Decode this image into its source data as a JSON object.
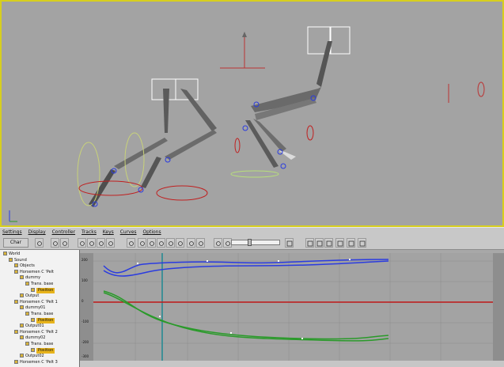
{
  "menubar": {
    "items": [
      "Settings",
      "Display",
      "Controller",
      "Tracks",
      "Keys",
      "Curves",
      "Options"
    ]
  },
  "toolbar": {
    "left_button_label": "Char",
    "icons": [
      "filter-icon",
      "move-keys-icon",
      "slide-keys-icon",
      "scale-keys-icon",
      "scale-values-icon",
      "add-keys-icon",
      "set-tangents-spline-icon",
      "set-tangents-fast-icon",
      "set-tangents-slow-icon",
      "set-tangents-step-icon",
      "set-tangents-linear-icon",
      "set-tangents-smooth-icon",
      "pan-icon",
      "zoom-horizontal-icon",
      "zoom-icon",
      "zoom-region-icon",
      "frame-icon"
    ]
  },
  "outliner": {
    "rows": [
      {
        "label": "World",
        "indent": 0,
        "highlight": false
      },
      {
        "label": "Sound",
        "indent": 1,
        "highlight": false
      },
      {
        "label": "Objects",
        "indent": 2,
        "highlight": false
      },
      {
        "label": "Horsemen C 'Pelt",
        "indent": 2,
        "highlight": false
      },
      {
        "label": "dummy",
        "indent": 3,
        "highlight": false
      },
      {
        "label": "Trans. base",
        "indent": 4,
        "highlight": false
      },
      {
        "label": "Position",
        "indent": 5,
        "highlight": true
      },
      {
        "label": "Output",
        "indent": 3,
        "highlight": false
      },
      {
        "label": "Horsemen C 'Pelt 1",
        "indent": 2,
        "highlight": false
      },
      {
        "label": "dummy01",
        "indent": 3,
        "highlight": false
      },
      {
        "label": "Trans. base",
        "indent": 4,
        "highlight": false
      },
      {
        "label": "Position",
        "indent": 5,
        "highlight": true
      },
      {
        "label": "Output01",
        "indent": 3,
        "highlight": false
      },
      {
        "label": "Horsemen C 'Pelt 2",
        "indent": 2,
        "highlight": false
      },
      {
        "label": "dummy02",
        "indent": 3,
        "highlight": false
      },
      {
        "label": "Trans. base",
        "indent": 4,
        "highlight": false
      },
      {
        "label": "Position",
        "indent": 5,
        "highlight": true
      },
      {
        "label": "Output02",
        "indent": 3,
        "highlight": false
      },
      {
        "label": "Horsemen C 'Pelt 3",
        "indent": 2,
        "highlight": false
      }
    ]
  },
  "graph": {
    "y_labels": [
      "200",
      "100",
      "0",
      "-100",
      "-200",
      "-300"
    ],
    "curve_colors": {
      "x": "#2a3be0",
      "y": "#2a9a2a",
      "z": "#c01818"
    },
    "time_slider_color": "#3f8f96"
  },
  "viewport": {
    "border_color": "#d7cf1e",
    "background": "#a3a3a3"
  }
}
